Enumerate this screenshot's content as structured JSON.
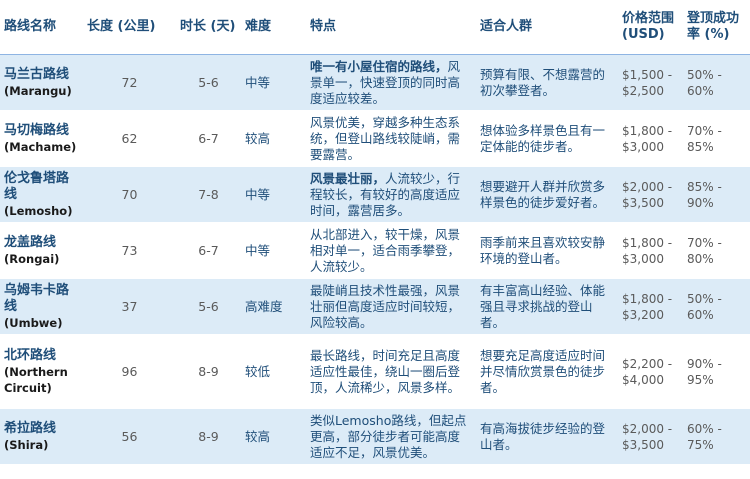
{
  "headers": {
    "name": "路线名称",
    "length": "长度 (公里)",
    "duration": "时长 (天)",
    "difficulty": "难度",
    "features": "特点",
    "audience": "适合人群",
    "price": "价格范围 (USD)",
    "success": "登顶成功率 (%)"
  },
  "rows": [
    {
      "name_cn": "马兰古路线",
      "name_en": "(Marangu)",
      "length": "72",
      "duration": "5-6",
      "difficulty": "中等",
      "feature_highlight": "唯一有小屋住宿的路线，",
      "feature_text": "风景单一，快速登顶的同时高度适应较差。",
      "audience": "预算有限、不想露营的初次攀登者。",
      "price": "$1,500 - $2,500",
      "success": "50% - 60%"
    },
    {
      "name_cn": "马切梅路线",
      "name_en": "(Machame)",
      "length": "62",
      "duration": "6-7",
      "difficulty": "较高",
      "feature_highlight": "",
      "feature_text": "风景优美，穿越多种生态系统，但登山路线较陡峭，需要露营。",
      "audience": "想体验多样景色且有一定体能的徒步者。",
      "price": "$1,800 - $3,000",
      "success": "70% - 85%"
    },
    {
      "name_cn": "伦戈鲁塔路线",
      "name_en": "(Lemosho)",
      "length": "70",
      "duration": "7-8",
      "difficulty": "中等",
      "feature_highlight": "风景最壮丽，",
      "feature_text": "人流较少，行程较长，有较好的高度适应时间，露营居多。",
      "audience": "想要避开人群并欣赏多样景色的徒步爱好者。",
      "price": "$2,000 - $3,500",
      "success": "85% - 90%"
    },
    {
      "name_cn": "龙盖路线",
      "name_en": "(Rongai)",
      "length": "73",
      "duration": "6-7",
      "difficulty": "中等",
      "feature_highlight": "",
      "feature_text": "从北部进入，较干燥，风景相对单一，适合雨季攀登，人流较少。",
      "audience": "雨季前来且喜欢较安静环境的登山者。",
      "price": "$1,800 - $3,000",
      "success": "70% - 80%"
    },
    {
      "name_cn": "乌姆韦卡路线",
      "name_en": "(Umbwe)",
      "length": "37",
      "duration": "5-6",
      "difficulty": "高难度",
      "feature_highlight": "",
      "feature_text": "最陡峭且技术性最强，风景壮丽但高度适应时间较短，风险较高。",
      "audience": "有丰富高山经验、体能强且寻求挑战的登山者。",
      "price": "$1,800 - $3,200",
      "success": "50% - 60%"
    },
    {
      "name_cn": "北环路线",
      "name_en": "(Northern Circuit)",
      "length": "96",
      "duration": "8-9",
      "difficulty": "较低",
      "feature_highlight": "",
      "feature_text": "最长路线，时间充足且高度适应性最佳，绕山一圈后登顶，人流稀少，风景多样。",
      "audience": "想要充足高度适应时间并尽情欣赏景色的徒步者。",
      "price": "$2,200 - $4,000",
      "success": "90% - 95%"
    },
    {
      "name_cn": "希拉路线",
      "name_en": "(Shira)",
      "length": "56",
      "duration": "8-9",
      "difficulty": "较高",
      "feature_highlight": "",
      "feature_text": "类似Lemosho路线，但起点更高，部分徒步者可能高度适应不足，风景优美。",
      "audience": "有高海拔徒步经验的登山者。",
      "price": "$2,000 - $3,500",
      "success": "60% - 75%"
    }
  ]
}
